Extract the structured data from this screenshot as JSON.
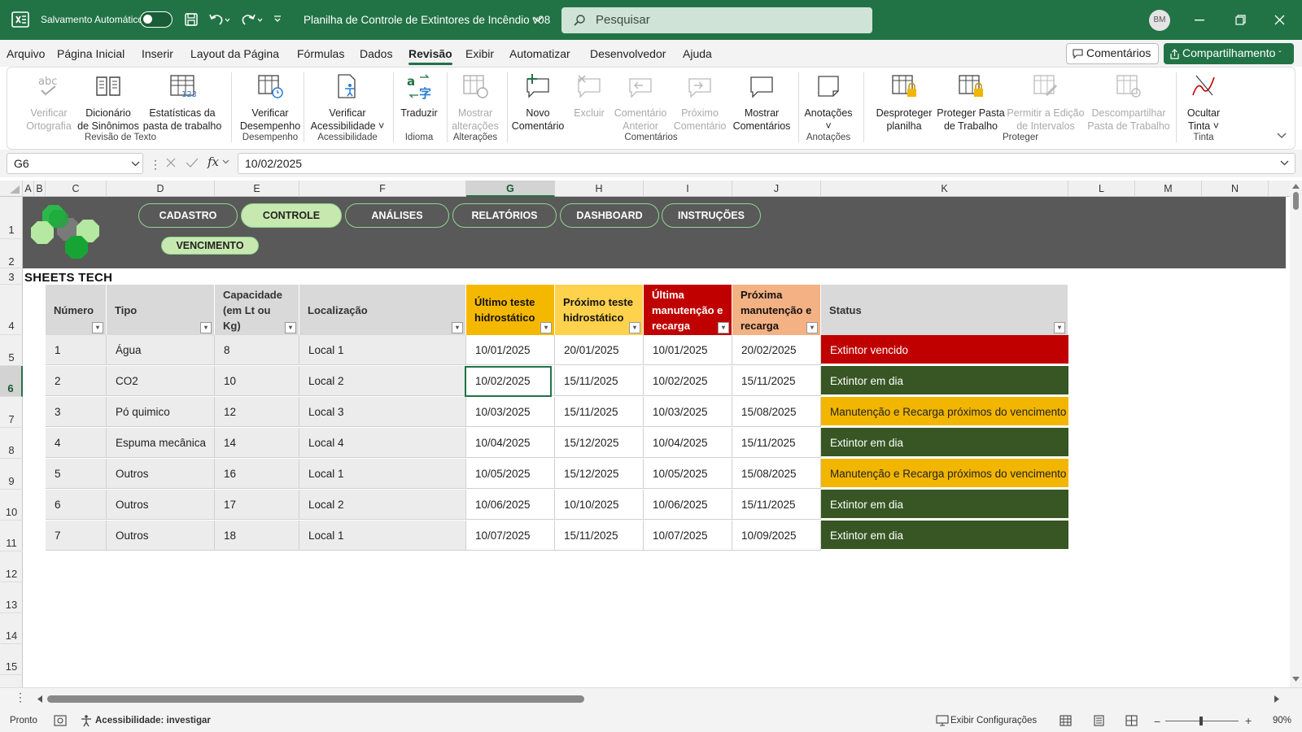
{
  "titlebar": {
    "autosave_label": "Salvamento Automático",
    "doc_title": "Planilha de Controle de Extintores de Incêndio v08",
    "search_placeholder": "Pesquisar",
    "avatar": "BM"
  },
  "menu": {
    "items": [
      "Arquivo",
      "Página Inicial",
      "Inserir",
      "Layout da Página",
      "Fórmulas",
      "Dados",
      "Revisão",
      "Exibir",
      "Automatizar",
      "Desenvolvedor",
      "Ajuda"
    ],
    "active": "Revisão",
    "comments_button": "Comentários",
    "share_button": "Compartilhamento"
  },
  "ribbon": {
    "buttons": [
      {
        "line1": "Verificar",
        "line2": "Ortografia",
        "icon": "spellcheck-icon",
        "enabled": false
      },
      {
        "line1": "Dicionário",
        "line2": "de Sinônimos",
        "icon": "thesaurus-icon",
        "enabled": true
      },
      {
        "line1": "Estatísticas da",
        "line2": "pasta de trabalho",
        "icon": "stats-icon",
        "enabled": true
      },
      {
        "line1": "Verificar",
        "line2": "Desempenho",
        "icon": "performance-icon",
        "enabled": true
      },
      {
        "line1": "Verificar",
        "line2": "Acessibilidade ˅",
        "icon": "accessibility-icon",
        "enabled": true
      },
      {
        "line1": "Traduzir",
        "line2": "",
        "icon": "translate-icon",
        "enabled": true
      },
      {
        "line1": "Mostrar",
        "line2": "alterações",
        "icon": "changes-icon",
        "enabled": false
      },
      {
        "line1": "Novo",
        "line2": "Comentário",
        "icon": "new-comment-icon",
        "enabled": true
      },
      {
        "line1": "Excluir",
        "line2": "",
        "icon": "delete-comment-icon",
        "enabled": false
      },
      {
        "line1": "Comentário",
        "line2": "Anterior",
        "icon": "prev-comment-icon",
        "enabled": false
      },
      {
        "line1": "Próximo",
        "line2": "Comentário",
        "icon": "next-comment-icon",
        "enabled": false
      },
      {
        "line1": "Mostrar",
        "line2": "Comentários",
        "icon": "show-comments-icon",
        "enabled": true
      },
      {
        "line1": "Anotações",
        "line2": "˅",
        "icon": "notes-icon",
        "enabled": true
      },
      {
        "line1": "Desproteger",
        "line2": "planilha",
        "icon": "unprotect-sheet-icon",
        "enabled": true
      },
      {
        "line1": "Proteger Pasta",
        "line2": "de Trabalho",
        "icon": "protect-workbook-icon",
        "enabled": true
      },
      {
        "line1": "Permitir a Edição",
        "line2": "de Intervalos",
        "icon": "allow-edit-icon",
        "enabled": false
      },
      {
        "line1": "Descompartilhar",
        "line2": "Pasta de Trabalho",
        "icon": "unshare-icon",
        "enabled": false
      },
      {
        "line1": "Ocultar",
        "line2": "Tinta ˅",
        "icon": "ink-icon",
        "enabled": true
      }
    ],
    "groups": [
      "Revisão de Texto",
      "Desempenho",
      "Acessibilidade",
      "Idioma",
      "Alterações",
      "Comentários",
      "Anotações",
      "Proteger",
      "Tinta"
    ]
  },
  "formula_bar": {
    "name_box": "G6",
    "value": "10/02/2025"
  },
  "columns": [
    "A",
    "B",
    "C",
    "D",
    "E",
    "F",
    "G",
    "H",
    "I",
    "J",
    "K",
    "L",
    "M",
    "N"
  ],
  "rows": [
    "1",
    "2",
    "3",
    "4",
    "5",
    "6",
    "7",
    "8",
    "9",
    "10",
    "11",
    "12",
    "13",
    "14",
    "15"
  ],
  "sheet": {
    "nav": [
      "CADASTRO",
      "CONTROLE",
      "ANÁLISES",
      "RELATÓRIOS",
      "DASHBOARD",
      "INSTRUÇÕES",
      "VENCIMENTO"
    ],
    "nav_active": "CONTROLE",
    "brand": "SHEETS TECH",
    "headers": [
      "Número",
      "Tipo",
      "Capacidade (em Lt ou Kg)",
      "Localização",
      "Último teste hidrostático",
      "Próximo teste hidrostático",
      "Última manutenção e recarga",
      "Próxima manutenção e recarga",
      "Status"
    ],
    "header_colors": {
      "g": "#f5b800",
      "h": "#ffd24d",
      "i": "#c00000",
      "j": "#f4b183"
    },
    "data": [
      [
        "1",
        "Água",
        "8",
        "Local 1",
        "10/01/2025",
        "20/01/2025",
        "10/01/2025",
        "20/02/2025",
        "Extintor vencido"
      ],
      [
        "2",
        "CO2",
        "10",
        "Local 2",
        "10/02/2025",
        "15/11/2025",
        "10/02/2025",
        "15/11/2025",
        "Extintor em dia"
      ],
      [
        "3",
        "Pó quimico",
        "12",
        "Local 3",
        "10/03/2025",
        "15/11/2025",
        "10/03/2025",
        "15/08/2025",
        "Manutenção e Recarga próximos do vencimento"
      ],
      [
        "4",
        "Espuma mecânica",
        "14",
        "Local 4",
        "10/04/2025",
        "15/12/2025",
        "10/04/2025",
        "15/11/2025",
        "Extintor em dia"
      ],
      [
        "5",
        "Outros",
        "16",
        "Local 1",
        "10/05/2025",
        "15/12/2025",
        "10/05/2025",
        "15/08/2025",
        "Manutenção e Recarga próximos do vencimento"
      ],
      [
        "6",
        "Outros",
        "17",
        "Local 2",
        "10/06/2025",
        "10/10/2025",
        "10/06/2025",
        "15/11/2025",
        "Extintor em dia"
      ],
      [
        "7",
        "Outros",
        "18",
        "Local 1",
        "10/07/2025",
        "15/11/2025",
        "10/07/2025",
        "10/09/2025",
        "Extintor em dia"
      ]
    ],
    "status_colors": {
      "Extintor vencido": "#c00000",
      "Extintor em dia": "#375623",
      "Manutenção e Recarga próximos do vencimento": "#f2b600"
    }
  },
  "statusbar": {
    "ready": "Pronto",
    "accessibility": "Acessibilidade: investigar",
    "display_settings": "Exibir Configurações",
    "zoom": "90%"
  }
}
